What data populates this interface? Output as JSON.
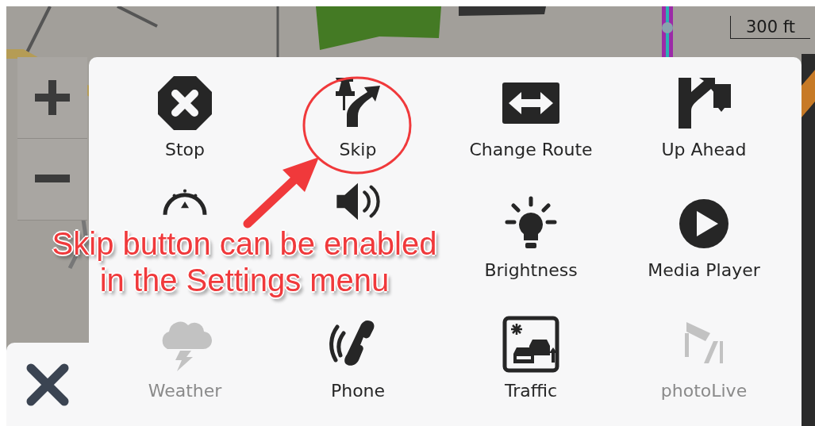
{
  "map": {
    "scale": "300 ft"
  },
  "menu": {
    "items": [
      {
        "label": "Stop",
        "disabled": false
      },
      {
        "label": "Skip",
        "disabled": false
      },
      {
        "label": "Change Route",
        "disabled": false
      },
      {
        "label": "Up Ahead",
        "disabled": false
      },
      {
        "disabled": false
      },
      {
        "disabled": false
      },
      {
        "label": "Brightness",
        "disabled": false
      },
      {
        "label": "Media Player",
        "disabled": false
      },
      {
        "label": "Weather",
        "disabled": true
      },
      {
        "label": "Phone",
        "disabled": false
      },
      {
        "label": "Traffic",
        "disabled": false
      },
      {
        "label": "photoLive",
        "disabled": true
      }
    ]
  },
  "annotation": {
    "lines": [
      "Skip button can be enabled",
      "in the Settings menu"
    ]
  }
}
